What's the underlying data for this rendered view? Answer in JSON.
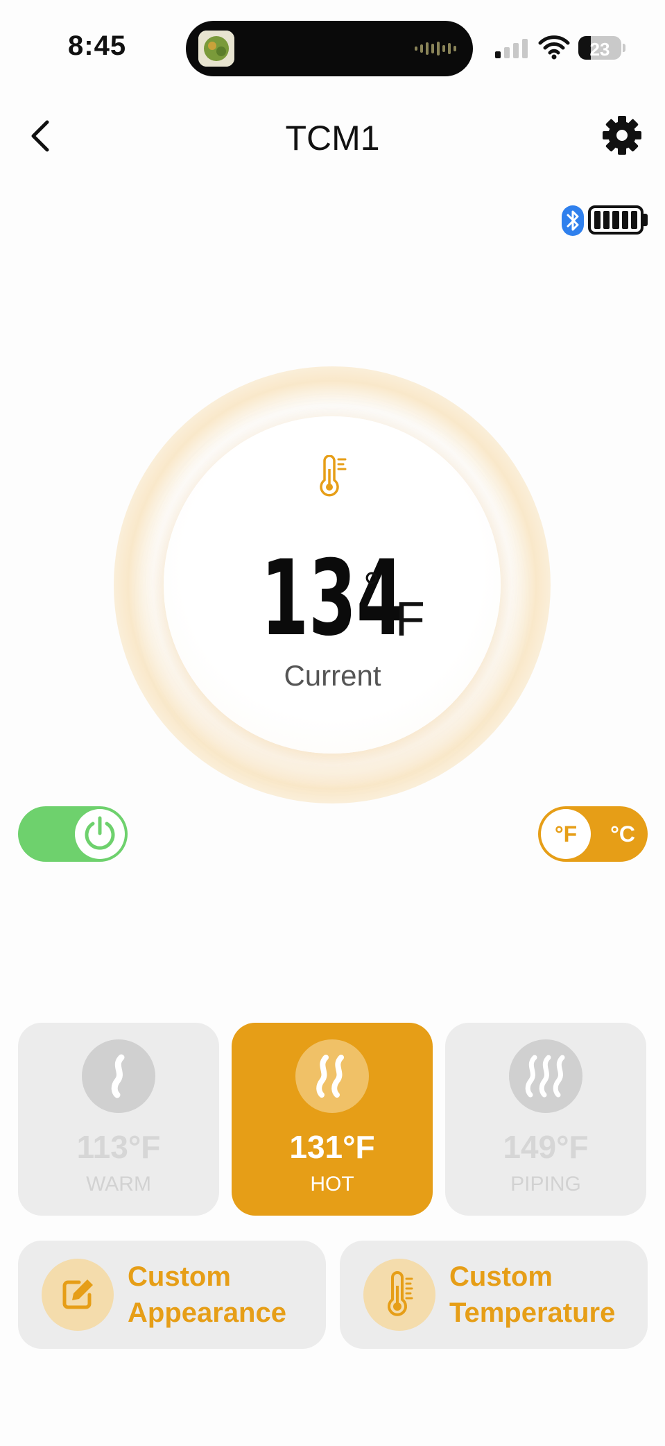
{
  "status_bar": {
    "time": "8:45",
    "battery_level": "23",
    "icons": [
      "signal-icon",
      "wifi-icon",
      "battery-icon"
    ]
  },
  "header": {
    "title": "TCM1",
    "back_icon": "chevron-left-icon",
    "settings_icon": "gear-icon"
  },
  "device_status": {
    "icons": [
      "bluetooth-icon",
      "battery-full-icon"
    ]
  },
  "dial": {
    "value": "134",
    "degree_symbol": "°",
    "unit": "F",
    "label": "Current",
    "icon": "thermometer-icon"
  },
  "toggles": {
    "power_on": true,
    "unit_f_label": "°F",
    "unit_c_label": "°C"
  },
  "presets": [
    {
      "temp": "113°F",
      "name": "WARM",
      "icon": "steam-one-wave-icon",
      "selected": false
    },
    {
      "temp": "131°F",
      "name": "HOT",
      "icon": "steam-two-waves-icon",
      "selected": true
    },
    {
      "temp": "149°F",
      "name": "PIPING",
      "icon": "steam-three-waves-icon",
      "selected": false
    }
  ],
  "custom_buttons": [
    {
      "line1": "Custom",
      "line2": "Appearance",
      "icon": "edit-icon"
    },
    {
      "line1": "Custom",
      "line2": "Temperature",
      "icon": "thermometer-icon"
    }
  ],
  "colors": {
    "accent": "#e69e17",
    "power_green": "#6ed16d",
    "card_bg": "#ececec",
    "bluetooth": "#2f80ed"
  }
}
